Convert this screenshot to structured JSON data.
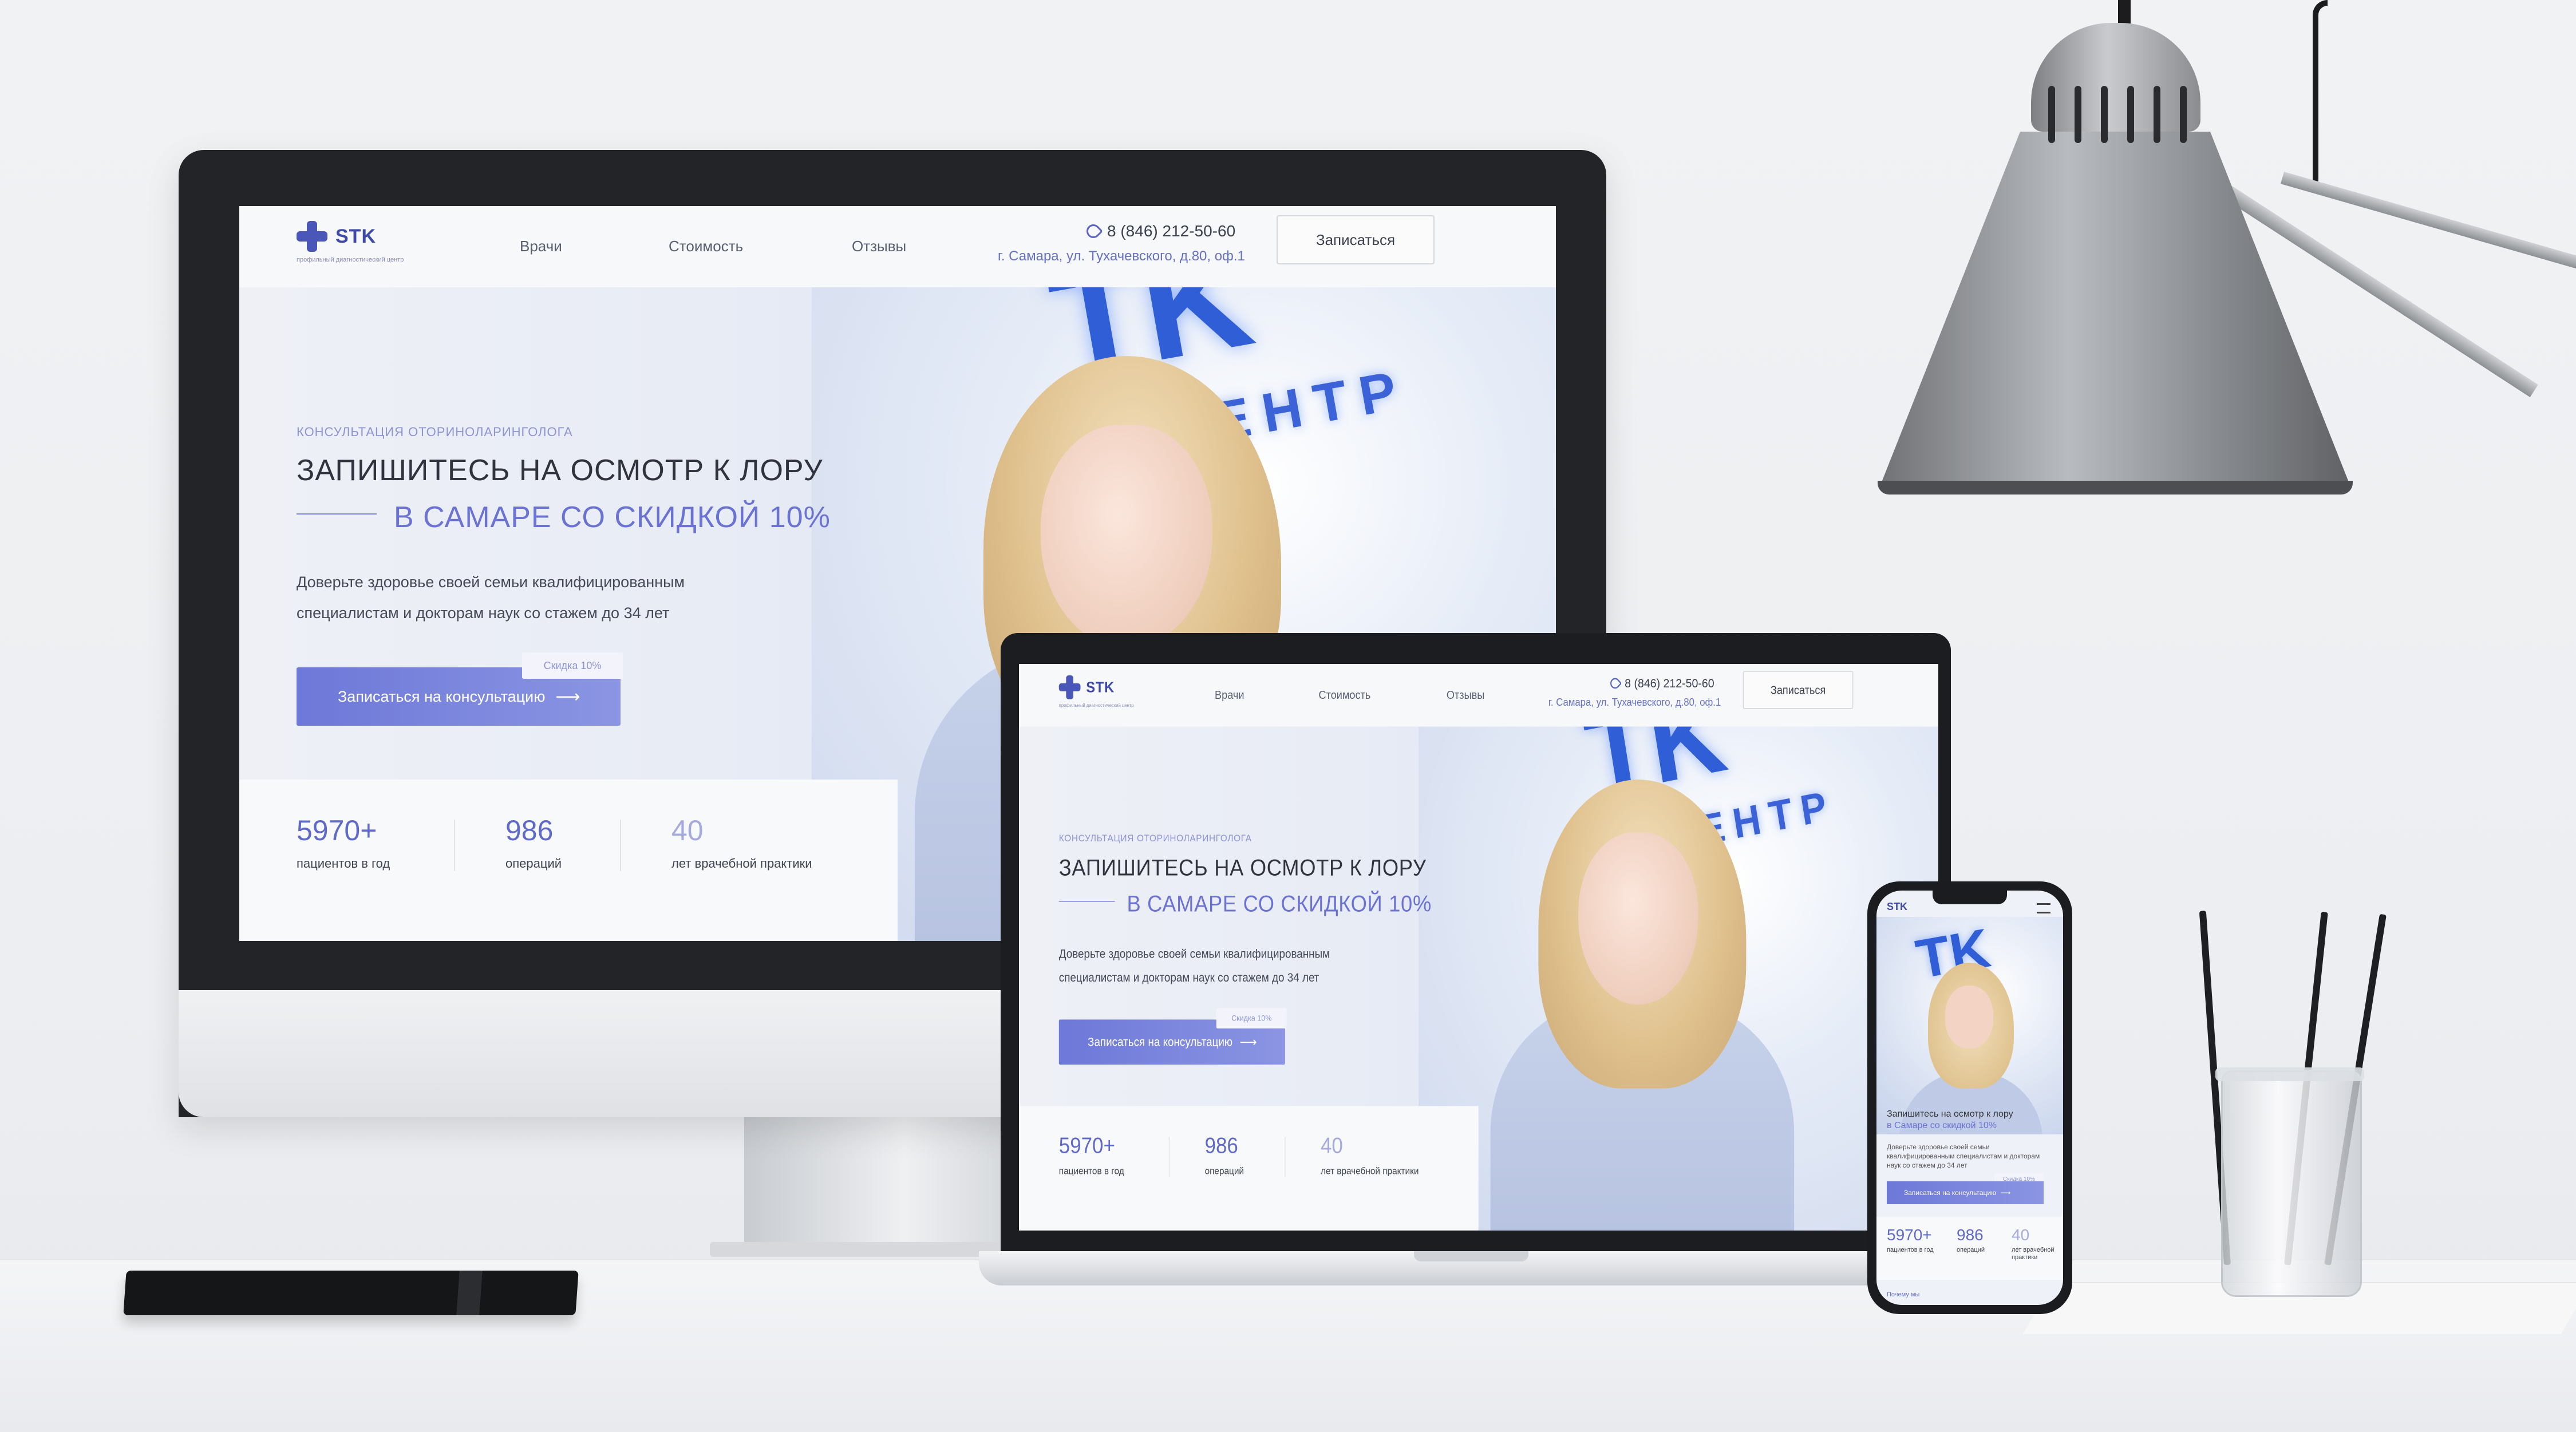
{
  "site": {
    "logo": "STK",
    "logo_sub": "профильный диагностический центр",
    "nav": [
      "Врачи",
      "Стоимость",
      "Отзывы"
    ],
    "phone": "8 (846) 212-50-60",
    "address": "г. Самара, ул. Тухачевского, д.80, оф.1",
    "signup_button": "Записаться",
    "kicker": "КОНСУЛЬТАЦИЯ ОТОРИНОЛАРИНГОЛОГА",
    "headline": "ЗАПИШИТЕСЬ НА ОСМОТР К ЛОРУ",
    "headline_accent": "В САМАРЕ СО СКИДКОЙ 10%",
    "description": "Доверьте здоровье своей семьи квалифицированным специалистам и докторам наук со стажем до 34 лет",
    "cta": "Записаться на консультацию",
    "cta_arrow": "⟶",
    "badge": "Скидка 10%",
    "sign_small": "ИЙ ЦЕНТР",
    "sign_big": "TK",
    "stats": [
      {
        "value": "5970+",
        "label": "пациентов в год"
      },
      {
        "value": "986",
        "label": "операций"
      },
      {
        "value": "40",
        "label": "лет врачебной практики"
      }
    ]
  },
  "phone_site": {
    "logo": "STK",
    "headline": "Запишитесь на осмотр к лору",
    "headline_accent": "в Самаре со скидкой 10%",
    "description": "Доверьте здоровье своей семьи квалифицированным специалистам и докторам наук со стажем до 34 лет",
    "cta": "Записаться на консультацию",
    "badge": "Скидка 10%",
    "stats": [
      {
        "value": "5970+",
        "label": "пациентов в год"
      },
      {
        "value": "986",
        "label": "операций"
      },
      {
        "value": "40",
        "label": "лет врачебной практики"
      }
    ],
    "footer_link": "Почему мы"
  },
  "colors": {
    "accent": "#6a73d3",
    "brand": "#3e4aa8",
    "button": "#7a84dc"
  }
}
